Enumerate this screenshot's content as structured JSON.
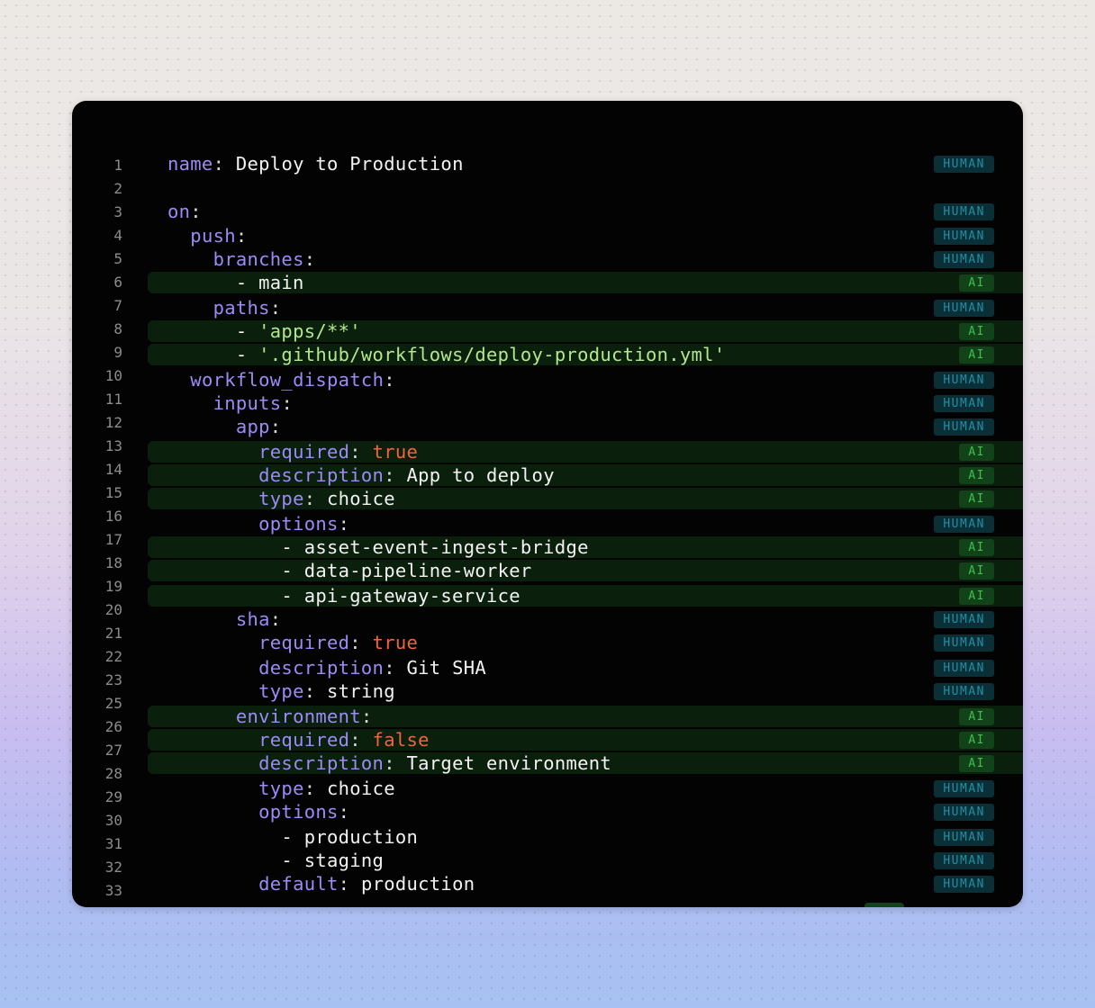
{
  "lines": [
    {
      "n": "1",
      "src": "AI0",
      "tokens": [
        [
          "name",
          "key"
        ],
        [
          ": ",
          "punct"
        ],
        [
          "Deploy to Production",
          "plain"
        ]
      ],
      "badge": "HUMAN"
    },
    {
      "n": "2",
      "tokens": [],
      "badge": ""
    },
    {
      "n": "3",
      "tokens": [
        [
          "on",
          "key"
        ],
        [
          ":",
          "punct"
        ]
      ],
      "badge": "HUMAN"
    },
    {
      "n": "4",
      "tokens": [
        [
          "  ",
          "plain"
        ],
        [
          "push",
          "key"
        ],
        [
          ":",
          "punct"
        ]
      ],
      "badge": "HUMAN"
    },
    {
      "n": "5",
      "tokens": [
        [
          "    ",
          "plain"
        ],
        [
          "branches",
          "key"
        ],
        [
          ":",
          "punct"
        ]
      ],
      "badge": "HUMAN"
    },
    {
      "n": "6",
      "tokens": [
        [
          "      - main",
          "plain"
        ]
      ],
      "badge": "AI"
    },
    {
      "n": "7",
      "tokens": [
        [
          "    ",
          "plain"
        ],
        [
          "paths",
          "key"
        ],
        [
          ":",
          "punct"
        ]
      ],
      "badge": "HUMAN"
    },
    {
      "n": "8",
      "tokens": [
        [
          "      - ",
          "plain"
        ],
        [
          "'apps/**'",
          "str"
        ]
      ],
      "badge": "AI"
    },
    {
      "n": "9",
      "tokens": [
        [
          "      - ",
          "plain"
        ],
        [
          "'.github/workflows/deploy-production.yml'",
          "str"
        ]
      ],
      "badge": "AI"
    },
    {
      "n": "10",
      "tokens": [
        [
          "  ",
          "plain"
        ],
        [
          "workflow_dispatch",
          "key"
        ],
        [
          ":",
          "punct"
        ]
      ],
      "badge": "HUMAN"
    },
    {
      "n": "11",
      "tokens": [
        [
          "    ",
          "plain"
        ],
        [
          "inputs",
          "key"
        ],
        [
          ":",
          "punct"
        ]
      ],
      "badge": "HUMAN"
    },
    {
      "n": "12",
      "tokens": [
        [
          "      ",
          "plain"
        ],
        [
          "app",
          "key"
        ],
        [
          ":",
          "punct"
        ]
      ],
      "badge": "HUMAN"
    },
    {
      "n": "13",
      "tokens": [
        [
          "        ",
          "plain"
        ],
        [
          "required",
          "key"
        ],
        [
          ": ",
          "punct"
        ],
        [
          "true",
          "bool"
        ]
      ],
      "badge": "AI"
    },
    {
      "n": "14",
      "tokens": [
        [
          "        ",
          "plain"
        ],
        [
          "description",
          "key"
        ],
        [
          ": ",
          "punct"
        ],
        [
          "App to deploy",
          "plain"
        ]
      ],
      "badge": "AI"
    },
    {
      "n": "15",
      "tokens": [
        [
          "        ",
          "plain"
        ],
        [
          "type",
          "key"
        ],
        [
          ": ",
          "punct"
        ],
        [
          "choice",
          "plain"
        ]
      ],
      "badge": "AI"
    },
    {
      "n": "16",
      "tokens": [
        [
          "        ",
          "plain"
        ],
        [
          "options",
          "key"
        ],
        [
          ":",
          "punct"
        ]
      ],
      "badge": "HUMAN"
    },
    {
      "n": "17",
      "tokens": [
        [
          "          - asset-event-ingest-bridge",
          "plain"
        ]
      ],
      "badge": "AI"
    },
    {
      "n": "18",
      "tokens": [
        [
          "          - data-pipeline-worker",
          "plain"
        ]
      ],
      "badge": "AI"
    },
    {
      "n": "19",
      "tokens": [
        [
          "          - api-gateway-service",
          "plain"
        ]
      ],
      "badge": "AI"
    },
    {
      "n": "20",
      "tokens": [
        [
          "      ",
          "plain"
        ],
        [
          "sha",
          "key"
        ],
        [
          ":",
          "punct"
        ]
      ],
      "badge": "HUMAN"
    },
    {
      "n": "21",
      "tokens": [
        [
          "        ",
          "plain"
        ],
        [
          "required",
          "key"
        ],
        [
          ": ",
          "punct"
        ],
        [
          "true",
          "bool"
        ]
      ],
      "badge": "HUMAN"
    },
    {
      "n": "22",
      "tokens": [
        [
          "        ",
          "plain"
        ],
        [
          "description",
          "key"
        ],
        [
          ": ",
          "punct"
        ],
        [
          "Git SHA",
          "plain"
        ]
      ],
      "badge": "HUMAN"
    },
    {
      "n": "23",
      "tokens": [
        [
          "        ",
          "plain"
        ],
        [
          "type",
          "key"
        ],
        [
          ": ",
          "punct"
        ],
        [
          "string",
          "plain"
        ]
      ],
      "badge": "HUMAN"
    },
    {
      "n": "25",
      "tokens": [
        [
          "      ",
          "plain"
        ],
        [
          "environment",
          "key"
        ],
        [
          ":",
          "punct"
        ]
      ],
      "badge": "AI"
    },
    {
      "n": "26",
      "tokens": [
        [
          "        ",
          "plain"
        ],
        [
          "required",
          "key"
        ],
        [
          ": ",
          "punct"
        ],
        [
          "false",
          "bool"
        ]
      ],
      "badge": "AI"
    },
    {
      "n": "27",
      "tokens": [
        [
          "        ",
          "plain"
        ],
        [
          "description",
          "key"
        ],
        [
          ": ",
          "punct"
        ],
        [
          "Target environment",
          "plain"
        ]
      ],
      "badge": "AI"
    },
    {
      "n": "28",
      "tokens": [
        [
          "        ",
          "plain"
        ],
        [
          "type",
          "key"
        ],
        [
          ": ",
          "punct"
        ],
        [
          "choice",
          "plain"
        ]
      ],
      "badge": "HUMAN"
    },
    {
      "n": "29",
      "tokens": [
        [
          "        ",
          "plain"
        ],
        [
          "options",
          "key"
        ],
        [
          ":",
          "punct"
        ]
      ],
      "badge": "HUMAN"
    },
    {
      "n": "30",
      "tokens": [
        [
          "          - production",
          "plain"
        ]
      ],
      "badge": "HUMAN"
    },
    {
      "n": "31",
      "tokens": [
        [
          "          - staging",
          "plain"
        ]
      ],
      "badge": "HUMAN"
    },
    {
      "n": "32",
      "tokens": [
        [
          "        ",
          "plain"
        ],
        [
          "default",
          "key"
        ],
        [
          ": ",
          "punct"
        ],
        [
          "production",
          "plain"
        ]
      ],
      "badge": "HUMAN"
    },
    {
      "n": "33",
      "tokens": [],
      "badge": ""
    }
  ],
  "colors": {
    "key": "#9b8cf5",
    "string": "#b3e88a",
    "boolean": "#f0653a",
    "ai_row_bg": "#0b1f0d",
    "human_badge": "#1f8fa6",
    "ai_badge": "#3fbf4a"
  }
}
